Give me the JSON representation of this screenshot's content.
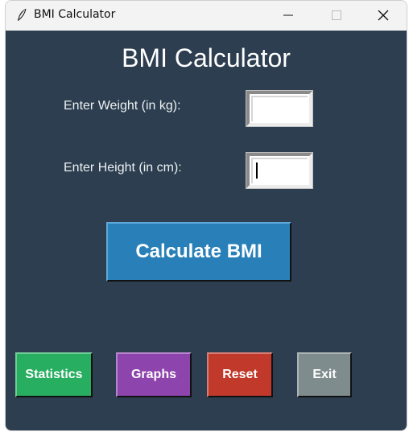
{
  "window": {
    "title": "BMI Calculator",
    "icon": "feather-icon"
  },
  "app": {
    "title": "BMI Calculator",
    "background": "#2c3e50"
  },
  "form": {
    "weight_label": "Enter Weight (in kg):",
    "weight_value": "",
    "height_label": "Enter Height (in cm):",
    "height_value": ""
  },
  "buttons": {
    "calculate": {
      "label": "Calculate BMI",
      "color": "#2980b9"
    },
    "statistics": {
      "label": "Statistics",
      "color": "#27ae60"
    },
    "graphs": {
      "label": "Graphs",
      "color": "#8e44ad"
    },
    "reset": {
      "label": "Reset",
      "color": "#c0392b"
    },
    "exit": {
      "label": "Exit",
      "color": "#7f8c8d"
    }
  }
}
